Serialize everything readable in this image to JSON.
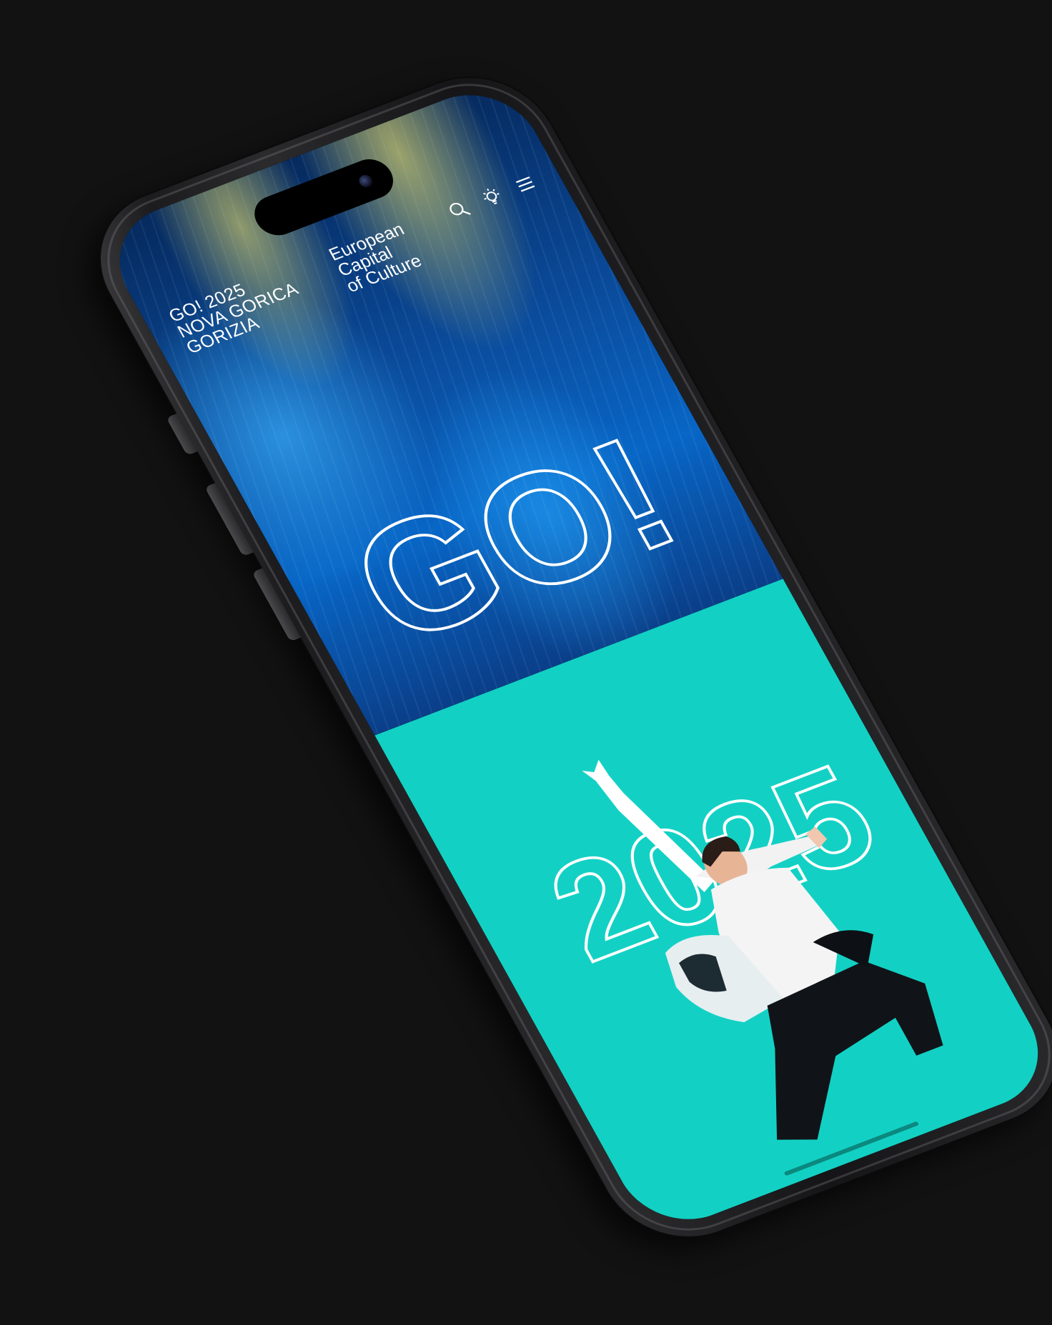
{
  "header": {
    "logo_lines": [
      "GO! 2025",
      "NOVA GORICA",
      "GORIZIA"
    ],
    "tagline_lines": [
      "European",
      "Capital",
      "of Culture"
    ]
  },
  "icons": [
    "search-icon",
    "sun-bulb-icon",
    "menu-icon"
  ],
  "hero": {
    "headline": "GO!"
  },
  "teal_section": {
    "headline": "2025"
  },
  "colors": {
    "background": "#121212",
    "hero_blue": "#0866c6",
    "teal": "#12d1c4",
    "text": "#ffffff"
  }
}
